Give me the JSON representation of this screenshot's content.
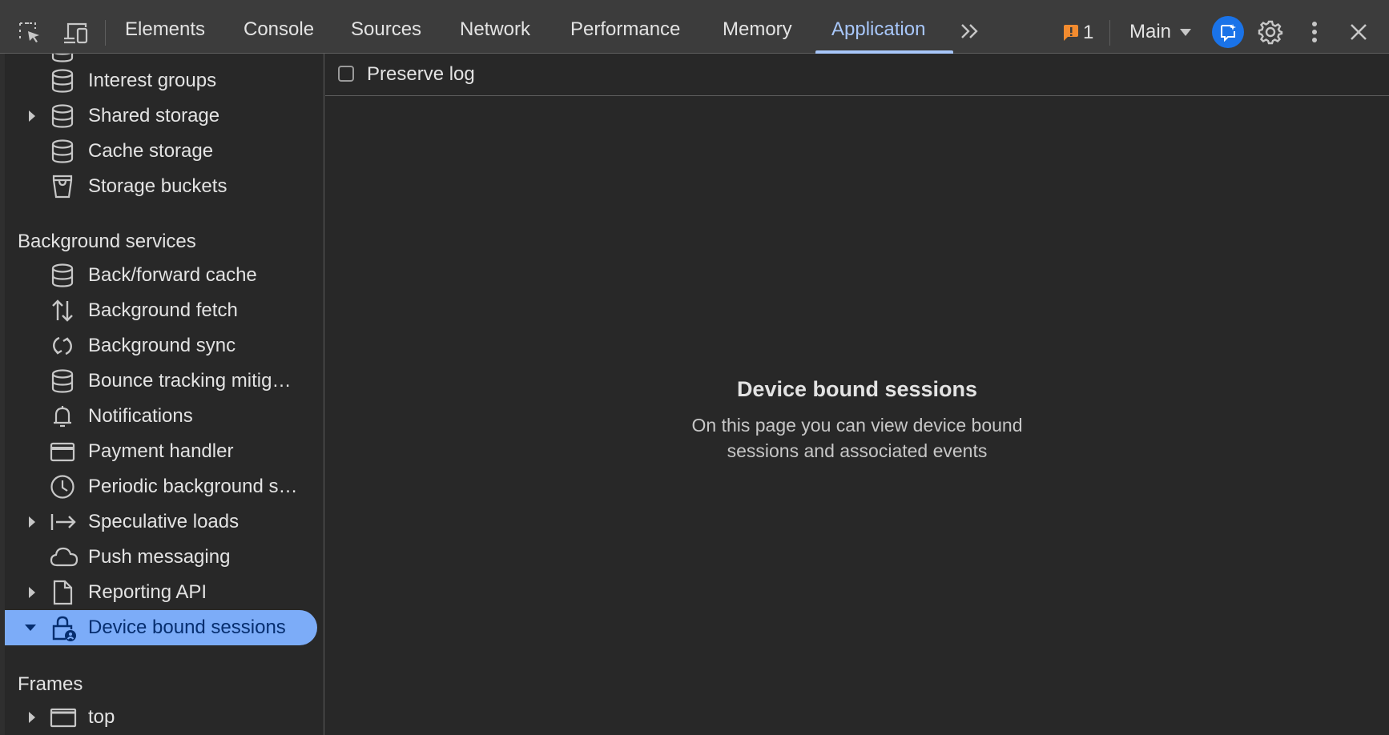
{
  "toolbar": {
    "tabs": [
      "Elements",
      "Console",
      "Sources",
      "Network",
      "Performance",
      "Memory",
      "Application"
    ],
    "active_tab": "Application",
    "issues_count": "1",
    "target_label": "Main",
    "accent": "#a8c7fa"
  },
  "sidebar": {
    "storage_items": [
      {
        "label": "Interest groups",
        "icon": "database-icon"
      },
      {
        "label": "Shared storage",
        "icon": "database-icon"
      },
      {
        "label": "Cache storage",
        "icon": "database-icon"
      },
      {
        "label": "Storage buckets",
        "icon": "bucket-icon"
      }
    ],
    "background_services": {
      "heading": "Background services",
      "items": [
        {
          "label": "Back/forward cache",
          "icon": "database-icon"
        },
        {
          "label": "Background fetch",
          "icon": "up-down-arrows-icon"
        },
        {
          "label": "Background sync",
          "icon": "sync-icon"
        },
        {
          "label": "Bounce tracking mitig…",
          "icon": "database-icon"
        },
        {
          "label": "Notifications",
          "icon": "bell-icon"
        },
        {
          "label": "Payment handler",
          "icon": "credit-card-icon"
        },
        {
          "label": "Periodic background s…",
          "icon": "clock-icon"
        },
        {
          "label": "Speculative loads",
          "icon": "arrow-right-bar-icon"
        },
        {
          "label": "Push messaging",
          "icon": "cloud-icon"
        },
        {
          "label": "Reporting API",
          "icon": "document-icon"
        },
        {
          "label": "Device bound sessions",
          "icon": "lock-icon"
        }
      ]
    },
    "frames": {
      "heading": "Frames",
      "items": [
        {
          "label": "top",
          "icon": "frame-icon"
        }
      ]
    },
    "selected_color": "#7cacf8"
  },
  "main": {
    "preserve_log_label": "Preserve log",
    "empty_title": "Device bound sessions",
    "empty_text": "On this page you can view device bound sessions and associated events"
  }
}
